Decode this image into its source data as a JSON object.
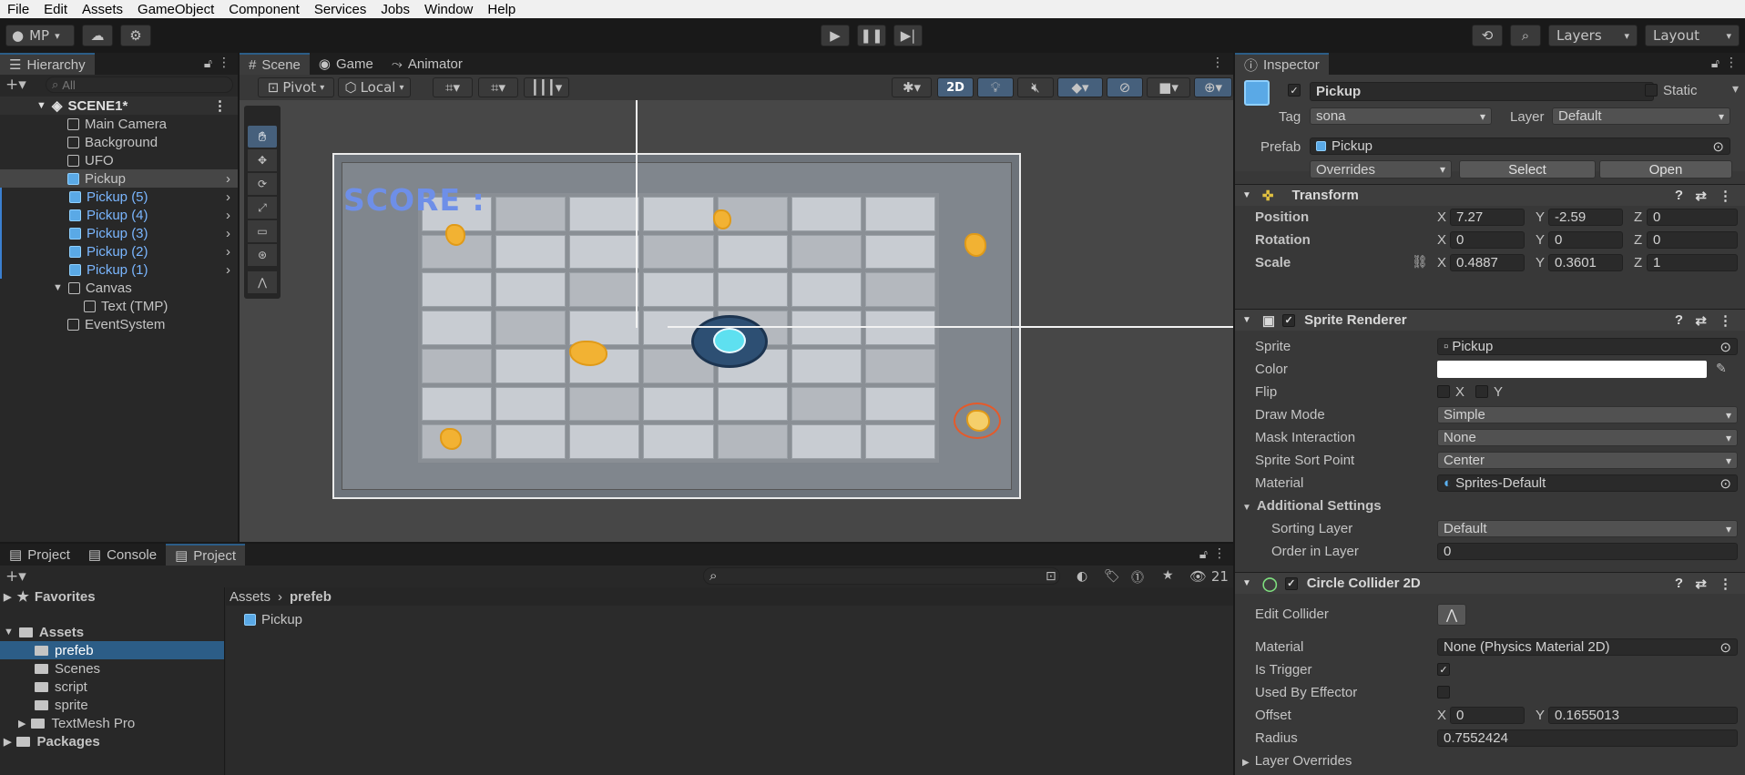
{
  "menu": [
    "File",
    "Edit",
    "Assets",
    "GameObject",
    "Component",
    "Services",
    "Jobs",
    "Window",
    "Help"
  ],
  "toolbar": {
    "account": "MP",
    "layers": "Layers",
    "layout": "Layout"
  },
  "hierarchy": {
    "tab": "Hierarchy",
    "search_placeholder": "All",
    "scene": "SCENE1*",
    "items": [
      {
        "label": "Main Camera"
      },
      {
        "label": "Background"
      },
      {
        "label": "UFO"
      },
      {
        "label": "Pickup"
      },
      {
        "label": "Pickup (5)"
      },
      {
        "label": "Pickup (4)"
      },
      {
        "label": "Pickup (3)"
      },
      {
        "label": "Pickup (2)"
      },
      {
        "label": "Pickup (1)"
      },
      {
        "label": "Canvas"
      },
      {
        "label": "Text (TMP)"
      },
      {
        "label": "EventSystem"
      }
    ]
  },
  "scene_tabs": [
    "Scene",
    "Game",
    "Animator"
  ],
  "scene_toolbar": {
    "pivot": "Pivot",
    "local": "Local",
    "mode_2d": "2D"
  },
  "score_text": "SCORE :",
  "bottom_tabs": [
    "Project",
    "Console",
    "Project"
  ],
  "project": {
    "search_count": "21",
    "favorites": "Favorites",
    "assets": "Assets",
    "folders": [
      "prefeb",
      "Scenes",
      "script",
      "sprite",
      "TextMesh Pro"
    ],
    "packages": "Packages",
    "breadcrumb": [
      "Assets",
      "prefeb"
    ],
    "files": [
      "Pickup"
    ]
  },
  "inspector": {
    "tab": "Inspector",
    "name": "Pickup",
    "static": "Static",
    "tag_label": "Tag",
    "tag": "sona",
    "layer_label": "Layer",
    "layer": "Default",
    "prefab_label": "Prefab",
    "prefab": "Pickup",
    "overrides": "Overrides",
    "select": "Select",
    "open": "Open",
    "transform": {
      "title": "Transform",
      "position_label": "Position",
      "rotation_label": "Rotation",
      "scale_label": "Scale",
      "position": {
        "x": "7.27",
        "y": "-2.59",
        "z": "0"
      },
      "rotation": {
        "x": "0",
        "y": "0",
        "z": "0"
      },
      "scale": {
        "x": "0.4887",
        "y": "0.3601",
        "z": "1"
      }
    },
    "sprite_renderer": {
      "title": "Sprite Renderer",
      "sprite_label": "Sprite",
      "sprite": "Pickup",
      "color_label": "Color",
      "flip_label": "Flip",
      "flip_x": "X",
      "flip_y": "Y",
      "draw_mode_label": "Draw Mode",
      "draw_mode": "Simple",
      "mask_label": "Mask Interaction",
      "mask": "None",
      "sort_point_label": "Sprite Sort Point",
      "sort_point": "Center",
      "material_label": "Material",
      "material": "Sprites-Default",
      "additional": "Additional Settings",
      "sorting_layer_label": "Sorting Layer",
      "sorting_layer": "Default",
      "order_label": "Order in Layer",
      "order": "0"
    },
    "collider": {
      "title": "Circle Collider 2D",
      "edit_label": "Edit Collider",
      "material_label": "Material",
      "material": "None (Physics Material 2D)",
      "trigger_label": "Is Trigger",
      "effector_label": "Used By Effector",
      "offset_label": "Offset",
      "offset_x": "0",
      "offset_y": "0.1655013",
      "radius_label": "Radius",
      "radius": "0.7552424",
      "layer_overrides": "Layer Overrides"
    }
  },
  "axis": {
    "x": "X",
    "y": "Y",
    "z": "Z"
  }
}
